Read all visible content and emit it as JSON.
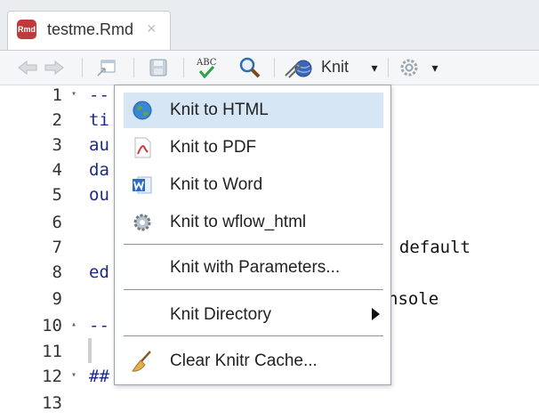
{
  "tab": {
    "icon_text": "Rmd",
    "filename": "testme.Rmd",
    "close_glyph": "×"
  },
  "toolbar": {
    "knit_label": "Knit",
    "spellcheck_text": "ABC",
    "dropdown_glyph": "▾",
    "icons": [
      "back-arrow-icon",
      "forward-arrow-icon",
      "show-in-window-icon",
      "save-icon",
      "spellcheck-icon",
      "find-icon",
      "knit-icon",
      "gear-icon"
    ]
  },
  "editor": {
    "lines": [
      {
        "n": "1",
        "fold": "▾",
        "code": "--"
      },
      {
        "n": "2",
        "fold": "",
        "code": "ti"
      },
      {
        "n": "3",
        "fold": "",
        "code": "au"
      },
      {
        "n": "4",
        "fold": "",
        "code": "da"
      },
      {
        "n": "5",
        "fold": "",
        "code": "ou"
      },
      {
        "n": "6",
        "fold": "",
        "code": ""
      },
      {
        "n": "7",
        "fold": "",
        "code": ""
      },
      {
        "n": "8",
        "fold": "",
        "code": "ed"
      },
      {
        "n": "9",
        "fold": "",
        "code": ""
      },
      {
        "n": "10",
        "fold": "▴",
        "code": "--"
      },
      {
        "n": "11",
        "fold": "",
        "code": ""
      },
      {
        "n": "12",
        "fold": "▾",
        "code": "##"
      },
      {
        "n": "13",
        "fold": "",
        "code": ""
      }
    ],
    "right_fragments": [
      ": default",
      "nsole"
    ]
  },
  "menu": {
    "items": [
      {
        "label": "Knit to HTML",
        "icon": "globe-icon"
      },
      {
        "label": "Knit to PDF",
        "icon": "pdf-icon"
      },
      {
        "label": "Knit to Word",
        "icon": "word-icon"
      },
      {
        "label": "Knit to wflow_html",
        "icon": "gear-icon"
      },
      {
        "label": "Knit with Parameters...",
        "icon": ""
      },
      {
        "label": "Knit Directory",
        "icon": ""
      },
      {
        "label": "Clear Knitr Cache...",
        "icon": "broom-icon"
      }
    ],
    "highlight_color": "#d7e6f5"
  },
  "colors": {
    "code_blue": "#1b2a88",
    "rmd_red": "#bf3b3b"
  }
}
